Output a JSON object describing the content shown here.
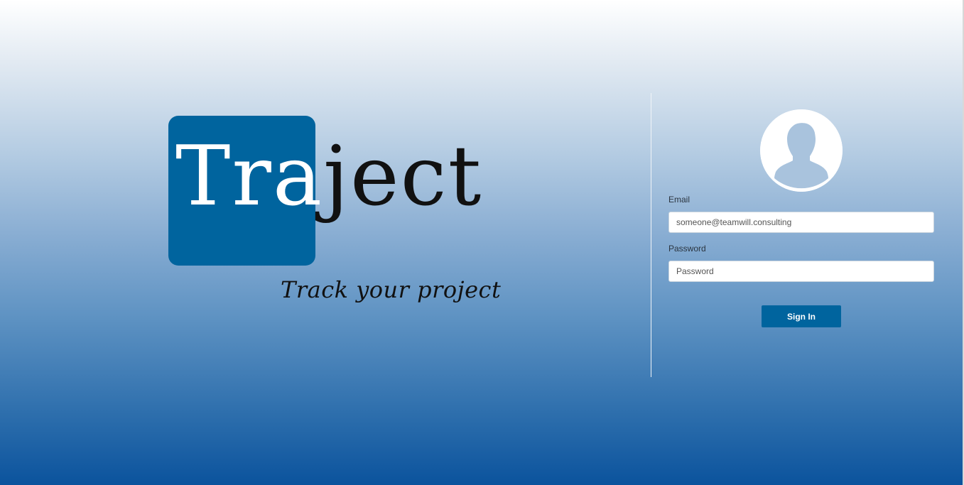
{
  "brand": {
    "logo_part_highlighted": "Tra",
    "logo_part_plain": "ject",
    "tagline": "Track your project",
    "box_color": "#00649e"
  },
  "login": {
    "avatar_icon": "user-silhouette-icon",
    "email_label": "Email",
    "email_placeholder": "someone@teamwill.consulting",
    "password_label": "Password",
    "password_placeholder": "Password",
    "signin_label": "Sign In",
    "button_color": "#00649e"
  }
}
